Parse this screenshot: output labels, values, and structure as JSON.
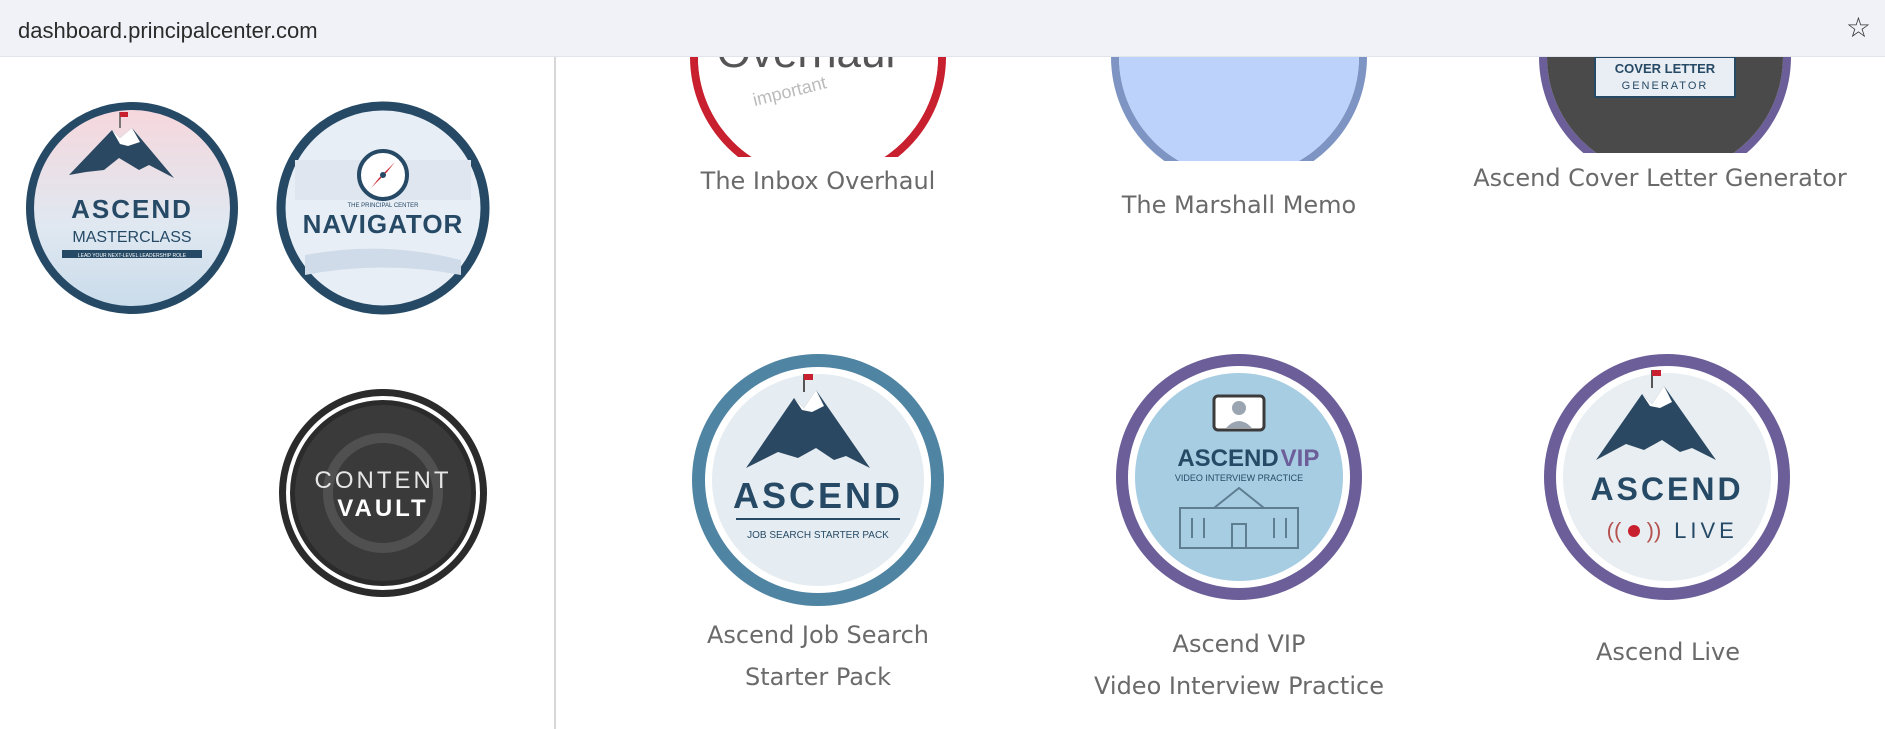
{
  "browser": {
    "url": "dashboard.principalcenter.com",
    "star_icon": "bookmark-star-icon"
  },
  "sidebar": {
    "badges": [
      {
        "line1": "ASCEND",
        "line2": "MASTERCLASS",
        "line3": "LEAD YOUR NEXT-LEVEL LEADERSHIP ROLE"
      },
      {
        "small": "THE PRINCIPAL CENTER",
        "title": "NAVIGATOR"
      },
      {
        "line1": "CONTENT",
        "line2": "VAULT"
      }
    ]
  },
  "products": {
    "top": [
      {
        "label": "The Inbox Overhaul",
        "badge_text": "Overhaul",
        "sub": "important"
      },
      {
        "label": "The Marshall Memo"
      },
      {
        "label": "Ascend Cover Letter Generator",
        "badge_line1": "COVER LETTER",
        "badge_line2": "GENERATOR"
      }
    ],
    "bottom": [
      {
        "label_line1": "Ascend Job Search",
        "label_line2": "Starter Pack",
        "badge_title": "ASCEND",
        "badge_sub": "JOB SEARCH STARTER PACK"
      },
      {
        "label_line1": "Ascend VIP",
        "label_line2": "Video Interview Practice",
        "badge_title": "ASCEND",
        "badge_title2": "VIP",
        "badge_sub": "VIDEO INTERVIEW PRACTICE"
      },
      {
        "label": "Ascend Live",
        "badge_title": "ASCEND",
        "badge_sub": "LIVE"
      }
    ]
  },
  "colors": {
    "navy": "#264a66",
    "red": "#c8202f",
    "periwinkle": "#7e95c4",
    "purple": "#6c5e98",
    "steel": "#4f84a3",
    "dark": "#2b2b2b",
    "caption": "#6a6a6a"
  }
}
